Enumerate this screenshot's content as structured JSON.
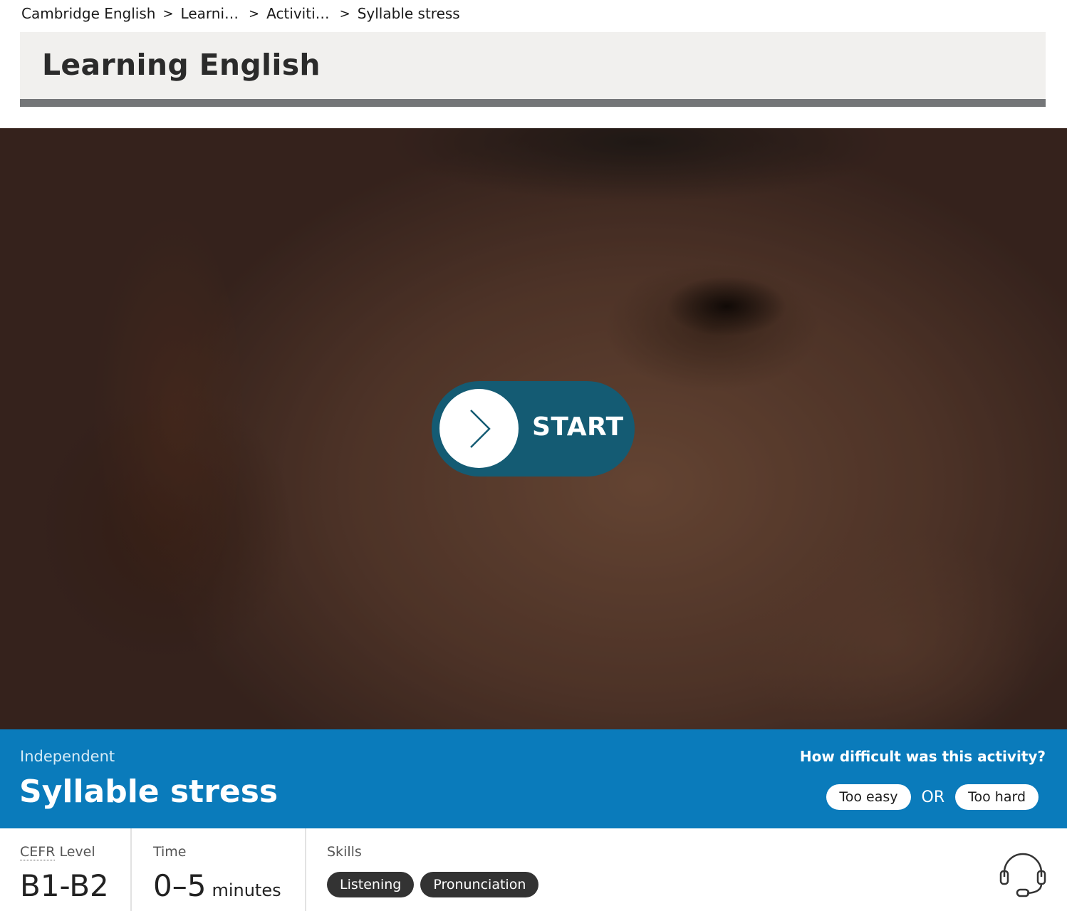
{
  "breadcrumb": {
    "items": [
      "Cambridge English",
      "Learni…",
      "Activiti…",
      "Syllable stress"
    ]
  },
  "header": {
    "title": "Learning English"
  },
  "hero": {
    "start_label": "START"
  },
  "activity": {
    "level": "Independent",
    "name": "Syllable stress",
    "difficulty_question": "How difficult was this activity?",
    "too_easy": "Too easy",
    "or": "OR",
    "too_hard": "Too hard"
  },
  "info": {
    "cefr_label_abbr": "CEFR",
    "cefr_label_rest": " Level",
    "cefr_value": "B1-B2",
    "time_label": "Time",
    "time_value": "0–5",
    "time_unit": "minutes",
    "skills_label": "Skills",
    "skills": [
      "Listening",
      "Pronunciation"
    ]
  },
  "icons": {
    "start": "chevron-right-icon",
    "support": "headset-icon"
  },
  "colors": {
    "activity_band": "#0a7bbb",
    "start_button": "#145b73",
    "header_band": "#f1f0ee",
    "header_rule": "#747678",
    "skill_pill": "#333333"
  }
}
